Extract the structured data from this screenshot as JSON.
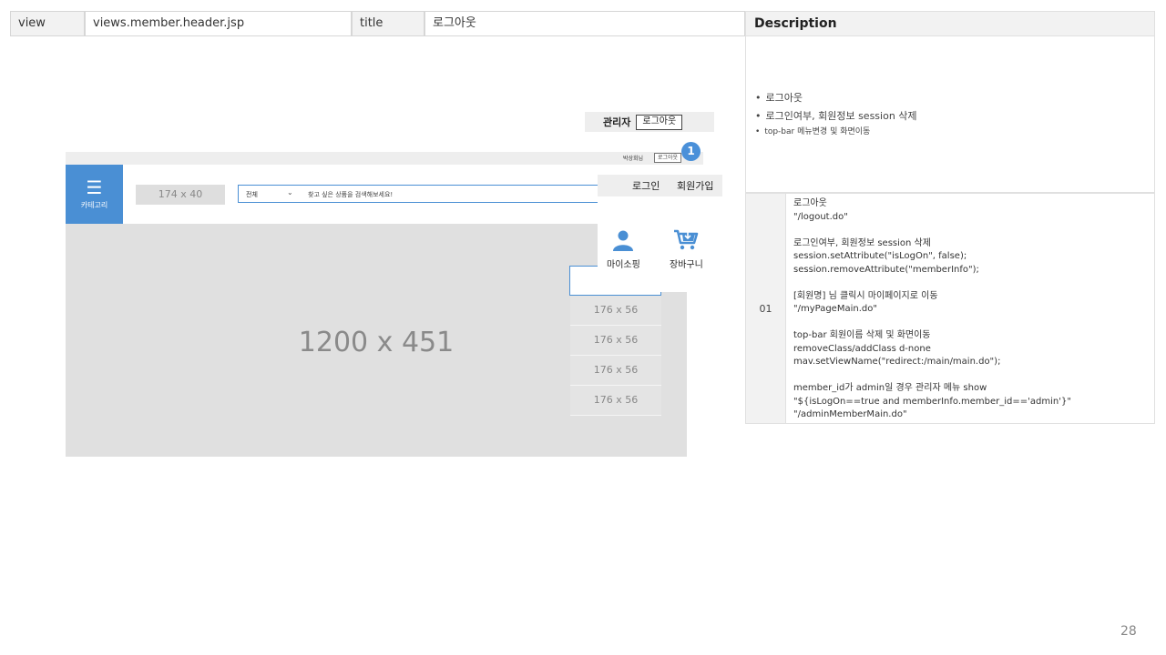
{
  "header": {
    "view_label": "view",
    "view_value": "views.member.header.jsp",
    "title_label": "title",
    "title_value": "로그아웃",
    "description_label": "Description"
  },
  "description": {
    "bullets": [
      "로그아웃",
      "로그인여부, 회원정보 session 삭제",
      "top-bar 메뉴변경 및 화면이동"
    ],
    "row_number": "01",
    "lines": [
      "로그아웃",
      "\"/logout.do\"",
      "",
      "로그인여부, 회원정보 session 삭제",
      "session.setAttribute(\"isLogOn\", false);",
      "session.removeAttribute(\"memberInfo\");",
      "",
      "[회원명] 님 클릭시 마이페이지로 이동",
      "\"/myPageMain.do\"",
      "",
      "top-bar 회원이름 삭제 및 화면이동",
      "removeClass/addClass d-none",
      "mav.setViewName(\"redirect:/main/main.do\");",
      "",
      "member_id가 admin일 경우 관리자 메뉴 show",
      "\"${isLogOn==true and memberInfo.member_id=='admin'}\"",
      "\"/adminMemberMain.do\""
    ]
  },
  "admin_bar": {
    "admin": "관리자",
    "logout": "로그아웃"
  },
  "mockup": {
    "user_name": "박상회님",
    "mini_logout": "로그아웃",
    "badge": "1",
    "category_label": "카테고리",
    "logo_placeholder": "174 x 40",
    "search_select": "전체",
    "search_placeholder": "찾고 싶은 상품을 검색해보세요!",
    "hero": "1200 x 451",
    "rail_items": [
      "176 x 56",
      "176 x 56",
      "176 x 56",
      "176 x 56"
    ]
  },
  "popup": {
    "login": "로그인",
    "join": "회원가입",
    "my_shopping": "마이소핑",
    "cart": "장바구니"
  },
  "page_number": "28",
  "colors": {
    "accent": "#4a8fd4",
    "badge": "#4a90d9",
    "placeholder": "#e0e0e0"
  }
}
